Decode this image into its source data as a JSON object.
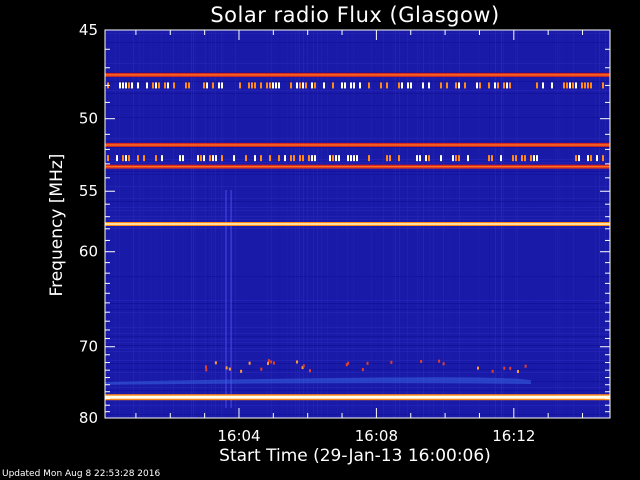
{
  "title": "Solar radio Flux (Glasgow)",
  "updated": "Updated Mon Aug  8 22:53:28 2016",
  "chart_data": {
    "type": "heatmap",
    "title": "Solar radio Flux (Glasgow)",
    "xlabel": "Start Time (29-Jan-13 16:00:06)",
    "ylabel": "Frequency [MHz]",
    "x_ticks": [
      "16:04",
      "16:08",
      "16:12"
    ],
    "x_tick_minutes": [
      4,
      8,
      12
    ],
    "xlim_minutes": [
      0.1,
      14.8
    ],
    "y_ticks": [
      45,
      50,
      55,
      60,
      70,
      80
    ],
    "ylim": [
      45,
      80
    ],
    "y_scale": "reciprocal",
    "grid": false,
    "colors": {
      "background": "#1a1aa8",
      "band_hot": "#ffffee",
      "band_warm": "#ff8a1a",
      "band_red": "#d8281f"
    },
    "bands": [
      {
        "freq_mhz": 47.4,
        "intensity": "red"
      },
      {
        "freq_mhz": 48.0,
        "intensity": "bursty"
      },
      {
        "freq_mhz": 51.7,
        "intensity": "red"
      },
      {
        "freq_mhz": 52.6,
        "intensity": "bursty"
      },
      {
        "freq_mhz": 53.2,
        "intensity": "red"
      },
      {
        "freq_mhz": 57.6,
        "intensity": "warm"
      },
      {
        "freq_mhz": 76.8,
        "intensity": "hot"
      }
    ]
  }
}
